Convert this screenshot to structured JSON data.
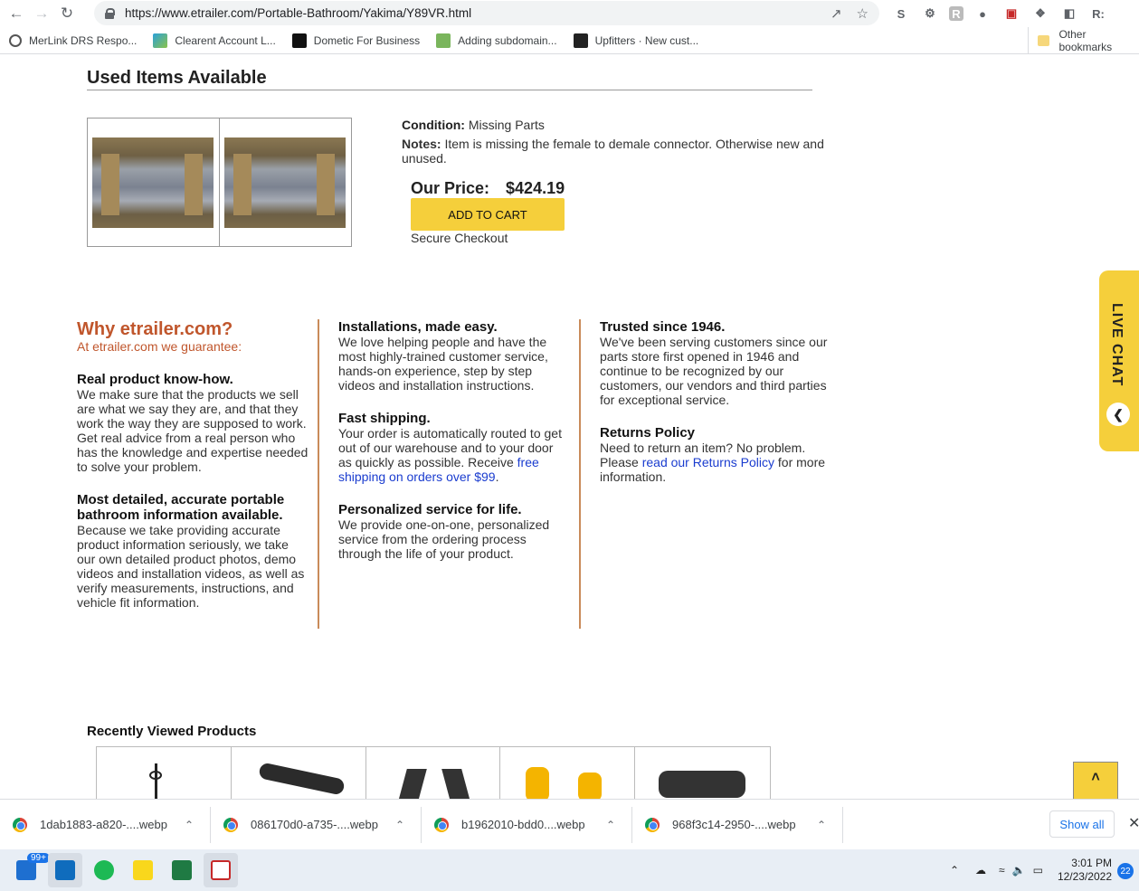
{
  "browser": {
    "url": "https://www.etrailer.com/Portable-Bathroom/Yakima/Y89VR.html",
    "bookmarks": [
      "MerLink DRS Respo...",
      "Clearent Account L...",
      "Dometic For Business",
      "Adding subdomain...",
      "Upfitters · New cust..."
    ],
    "other_bookmarks": "Other bookmarks"
  },
  "used": {
    "title": "Used Items Available",
    "condition_label": "Condition:",
    "condition_value": "Missing Parts",
    "notes_label": "Notes:",
    "notes_value": "Item is missing the female to demale connector. Otherwise new and unused.",
    "price_label": "Our Price:",
    "price_value": "$424.19",
    "cart_label": "ADD TO CART",
    "secure": "Secure Checkout"
  },
  "why": {
    "title": "Why etrailer.com?",
    "subtitle": "At etrailer.com we guarantee:",
    "knowhow_h": "Real product know-how.",
    "knowhow_p": "We make sure that the products we sell are what we say they are, and that they work the way they are supposed to work. Get real advice from a real person who has the knowledge and expertise needed to solve your problem.",
    "detailed_h": "Most detailed, accurate portable bathroom information available.",
    "detailed_p": "Because we take providing accurate product information seriously, we take our own detailed product photos, demo videos and installation videos, as well as verify measurements, instructions, and vehicle fit information.",
    "install_h": "Installations, made easy.",
    "install_p": "We love helping people and have the most highly-trained customer service, hands-on experience, step by step videos and installation instructions.",
    "ship_h": "Fast shipping.",
    "ship_p": "Your order is automatically routed to get out of our warehouse and to your door as quickly as possible. Receive",
    "ship_link": "free shipping on orders over $99",
    "ship_end": ".",
    "personal_h": "Personalized service for life.",
    "personal_p": "We provide one-on-one, personalized service from the ordering process through the life of your product.",
    "trusted_h": "Trusted since 1946.",
    "trusted_p": "We've been serving customers since our parts store first opened in 1946 and continue to be recognized by our customers, our vendors and third parties for exceptional service.",
    "returns_h": "Returns Policy",
    "returns_p": "Need to return an item? No problem. Please",
    "returns_link": "read our Returns Policy",
    "returns_end": "for more information."
  },
  "recent": {
    "title": "Recently Viewed Products"
  },
  "live_chat": "LIVE CHAT",
  "scroll_top": "˄",
  "downloads": [
    "1dab1883-a820-....webp",
    "086170d0-a735-....webp",
    "b1962010-bdd0....webp",
    "968f3c14-2950-....webp"
  ],
  "show_all": "Show all",
  "taskbar": {
    "badge": "99+",
    "time": "3:01 PM",
    "date": "12/23/2022",
    "notifications": "22"
  },
  "colors": {
    "accent_orange": "#c0562c",
    "cart_yellow": "#f5cf3b",
    "link_blue": "#1a3ccf"
  }
}
